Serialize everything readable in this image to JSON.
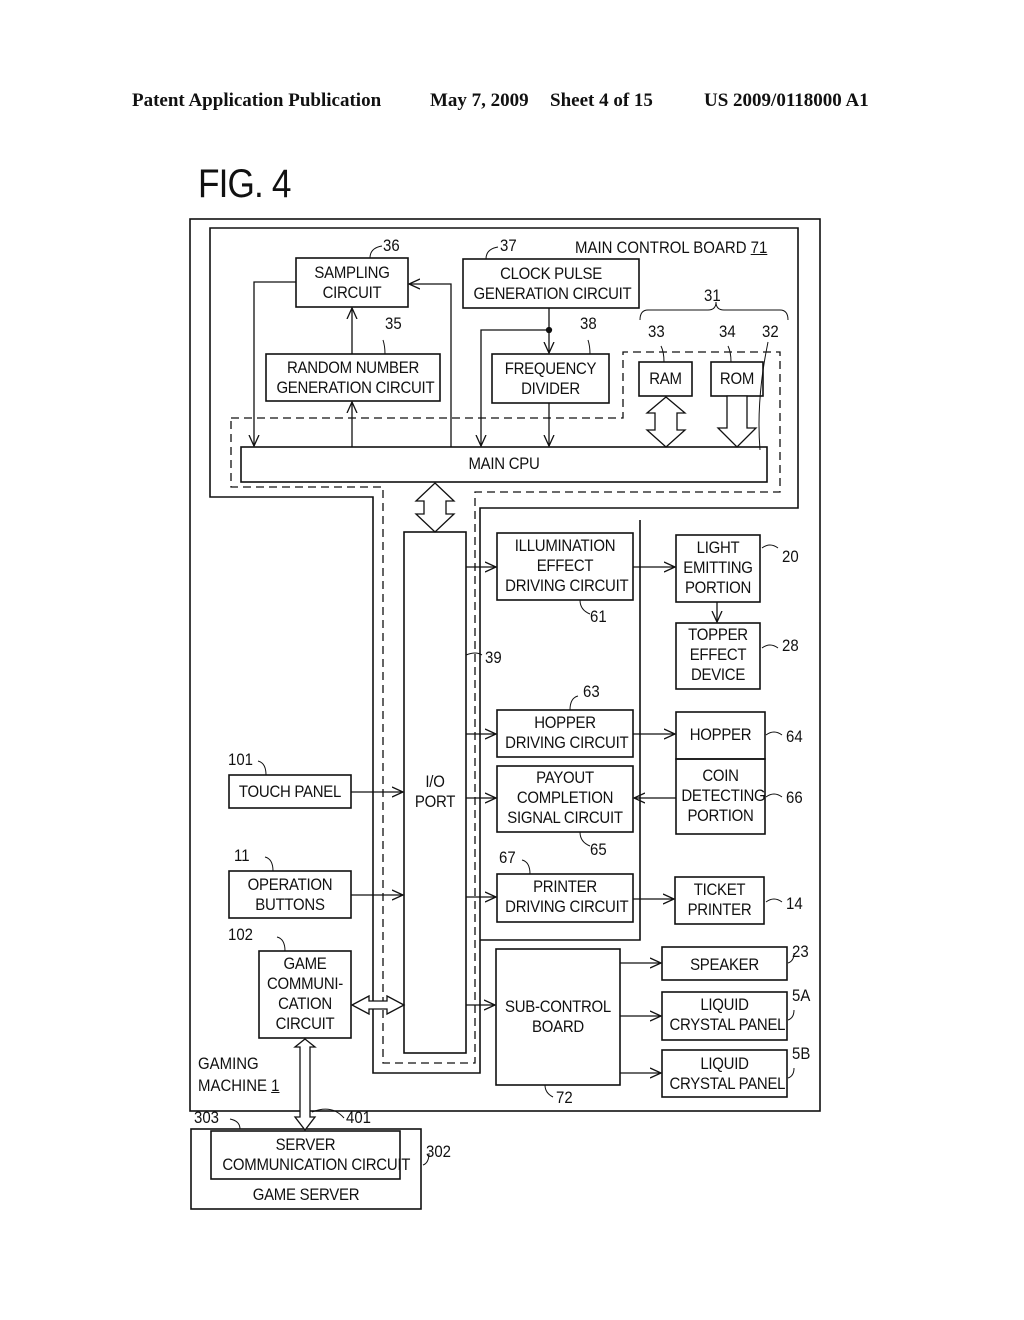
{
  "header": {
    "publication": "Patent Application Publication",
    "date": "May 7, 2009",
    "sheet": "Sheet 4 of 15",
    "patent_number": "US 2009/0118000 A1"
  },
  "figure": {
    "title": "FIG. 4"
  },
  "main_board": {
    "label": "MAIN CONTROL BOARD",
    "ref": "71"
  },
  "blocks": {
    "sampling": {
      "line1": "SAMPLING",
      "line2": "CIRCUIT",
      "ref": "36"
    },
    "random": {
      "line1": "RANDOM NUMBER",
      "line2": "GENERATION CIRCUIT",
      "ref": "35"
    },
    "clock": {
      "line1": "CLOCK PULSE",
      "line2": "GENERATION CIRCUIT",
      "ref": "37"
    },
    "freq": {
      "line1": "FREQUENCY",
      "line2": "DIVIDER",
      "ref": "38"
    },
    "ram": {
      "label": "RAM",
      "ref": "33"
    },
    "rom": {
      "label": "ROM",
      "ref": "34"
    },
    "cpu_group": {
      "ref": "31",
      "ref_cpu": "32"
    },
    "main_cpu": {
      "label": "MAIN CPU"
    },
    "io_port": {
      "line1": "I/O",
      "line2": "PORT",
      "bus_ref": "39"
    },
    "illum": {
      "line1": "ILLUMINATION",
      "line2": "EFFECT",
      "line3": "DRIVING CIRCUIT",
      "ref": "61"
    },
    "light": {
      "line1": "LIGHT",
      "line2": "EMITTING",
      "line3": "PORTION",
      "ref": "20"
    },
    "topper": {
      "line1": "TOPPER",
      "line2": "EFFECT",
      "line3": "DEVICE",
      "ref": "28"
    },
    "hopper_drv": {
      "line1": "HOPPER",
      "line2": "DRIVING CIRCUIT",
      "ref": "63"
    },
    "hopper": {
      "label": "HOPPER",
      "ref": "64"
    },
    "payout": {
      "line1": "PAYOUT",
      "line2": "COMPLETION",
      "line3": "SIGNAL CIRCUIT",
      "ref": "65"
    },
    "coin": {
      "line1": "COIN",
      "line2": "DETECTING",
      "line3": "PORTION",
      "ref": "66"
    },
    "touch": {
      "label": "TOUCH PANEL",
      "ref": "101"
    },
    "buttons": {
      "line1": "OPERATION",
      "line2": "BUTTONS",
      "ref": "11"
    },
    "printer_drv": {
      "line1": "PRINTER",
      "line2": "DRIVING CIRCUIT",
      "ref": "67"
    },
    "ticket": {
      "line1": "TICKET",
      "line2": "PRINTER",
      "ref": "14"
    },
    "game_comm": {
      "line1": "GAME",
      "line2": "COMMUNI-",
      "line3": "CATION",
      "line4": "CIRCUIT",
      "ref": "102"
    },
    "sub_board": {
      "line1": "SUB-CONTROL",
      "line2": "BOARD",
      "ref": "72"
    },
    "speaker": {
      "label": "SPEAKER",
      "ref": "23"
    },
    "lcd_a": {
      "line1": "LIQUID",
      "line2": "CRYSTAL PANEL",
      "ref": "5A"
    },
    "lcd_b": {
      "line1": "LIQUID",
      "line2": "CRYSTAL PANEL",
      "ref": "5B"
    },
    "server_comm": {
      "line1": "SERVER",
      "line2": "COMMUNICATION CIRCUIT",
      "ref": "303"
    },
    "game_server": {
      "label": "GAME SERVER",
      "ref": "302"
    },
    "network": {
      "ref": "401"
    }
  },
  "gaming_machine": {
    "line1": "GAMING",
    "line2": "MACHINE",
    "ref": "1"
  }
}
